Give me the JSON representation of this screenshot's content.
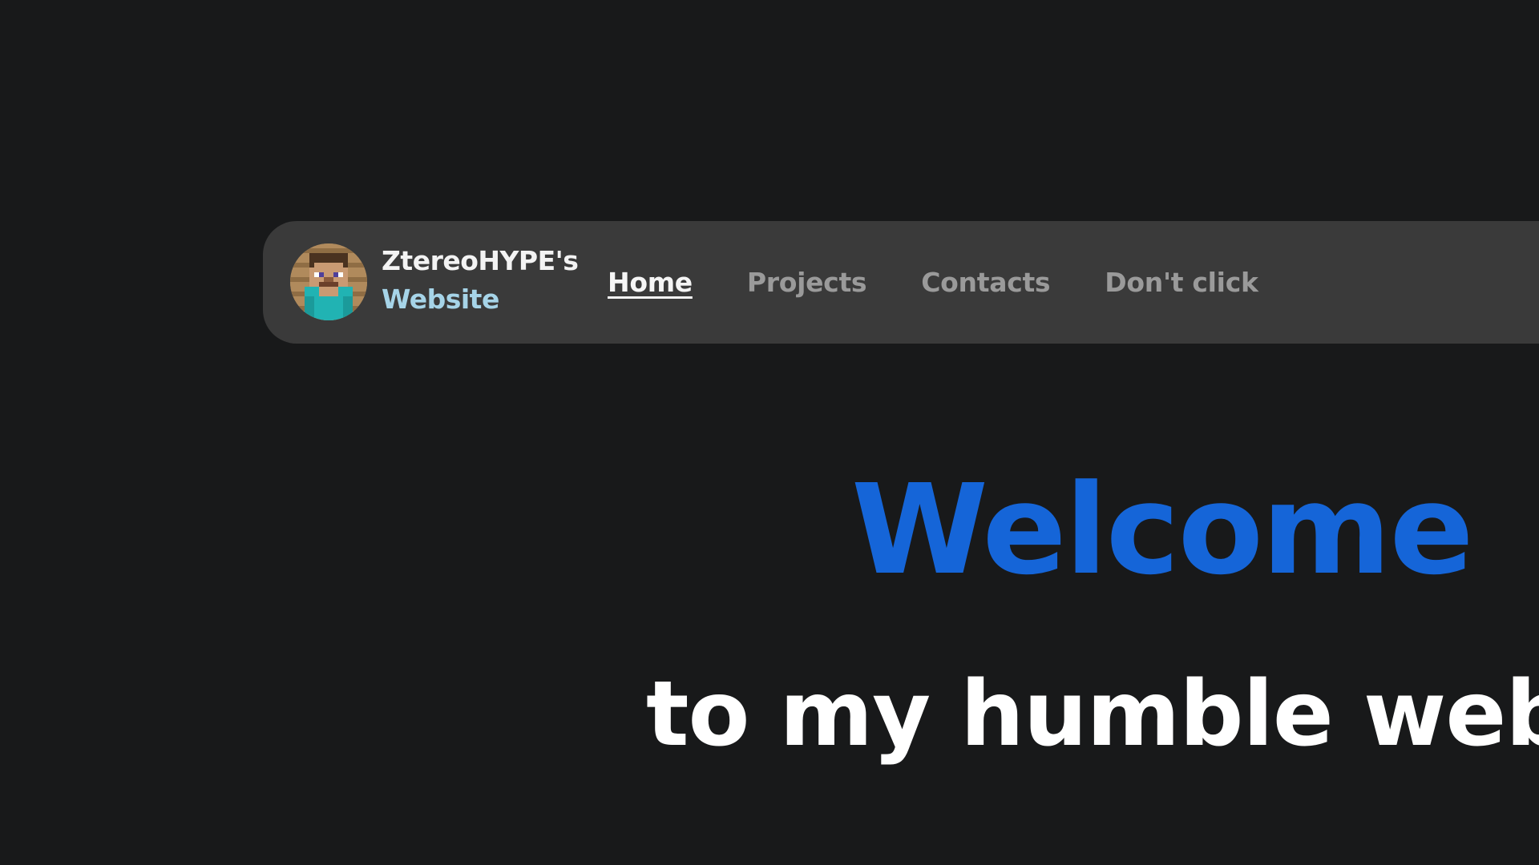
{
  "header": {
    "avatar_icon": "pixel-character-avatar-icon",
    "brand_line1": "ZtereoHYPE's",
    "brand_line2": "Website"
  },
  "nav": {
    "items": [
      {
        "label": "Home",
        "active": true
      },
      {
        "label": "Projects",
        "active": false
      },
      {
        "label": "Contacts",
        "active": false
      },
      {
        "label": "Don't click",
        "active": false
      }
    ]
  },
  "hero": {
    "title": "Welcome",
    "subtitle": "to my humble websi"
  },
  "colors": {
    "background": "#18191a",
    "navbar": "#3a3a3a",
    "accent_blue": "#1565d8",
    "brand_secondary": "#a6d4e8",
    "nav_inactive": "#9a9a9a"
  }
}
